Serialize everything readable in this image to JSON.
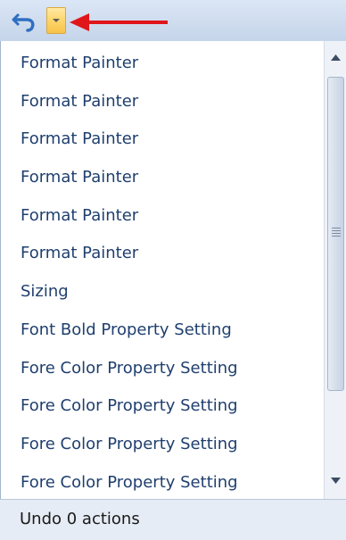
{
  "toolbar": {
    "undo_icon": "undo-icon",
    "dropdown_icon": "chevron-down-icon",
    "annotation_arrow_color": "#e0161b",
    "dropdown_highlight_color": "#fdd56a"
  },
  "undo_list": {
    "items": [
      "Format Painter",
      "Format Painter",
      "Format Painter",
      "Format Painter",
      "Format Painter",
      "Format Painter",
      "Sizing",
      "Font Bold Property Setting",
      "Fore Color Property Setting",
      "Fore Color Property Setting",
      "Fore Color Property Setting",
      "Fore Color Property Setting"
    ]
  },
  "footer": {
    "status": "Undo 0 actions"
  }
}
